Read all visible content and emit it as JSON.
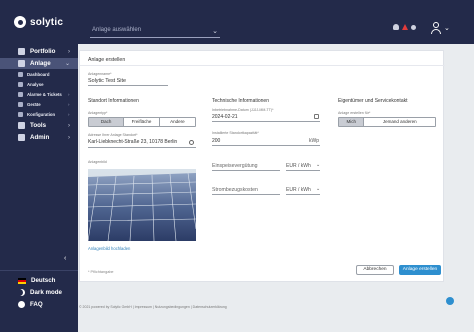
{
  "app": {
    "logo_text": "solytic"
  },
  "topbar": {
    "plant_select_placeholder": "Anlage auswählen",
    "icons": [
      "bell-icon",
      "alert-icon",
      "user-icon",
      "chevron-down-icon"
    ]
  },
  "sidebar": {
    "items": [
      {
        "label": "Portfolio",
        "icon": "portfolio-icon"
      },
      {
        "label": "Anlage",
        "icon": "plant-icon"
      }
    ],
    "sub_items": [
      {
        "label": "Dashboard",
        "icon": "dashboard-icon"
      },
      {
        "label": "Analyse",
        "icon": "analysis-icon"
      },
      {
        "label": "Alarme & Tickets",
        "icon": "alarm-icon"
      },
      {
        "label": "Geräte",
        "icon": "devices-icon"
      },
      {
        "label": "Konfiguration",
        "icon": "config-icon"
      }
    ],
    "lower_items": [
      {
        "label": "Tools",
        "icon": "tools-icon"
      },
      {
        "label": "Admin",
        "icon": "admin-icon"
      }
    ],
    "footer": [
      {
        "label": "Deutsch",
        "icon": "german-flag-icon"
      },
      {
        "label": "Dark mode",
        "icon": "moon-icon"
      },
      {
        "label": "FAQ",
        "icon": "help-icon"
      }
    ]
  },
  "form": {
    "title": "Anlage erstellen",
    "name_label": "Anlagenname*",
    "name_value": "Solytic Test Site",
    "section_location": "Standort Informationen",
    "section_technical": "Technische Informationen",
    "section_owner": "Eigentümer und Servicekontakt",
    "type_label": "Anlagentyp*",
    "type_options": [
      "Dach",
      "Freifläche",
      "Andere"
    ],
    "type_selected": "Dach",
    "address_label": "Adresse Ihrer Anlage Standort*",
    "address_value": "Karl-Liebknecht-Straße 23, 10178 Berlin",
    "photo_label": "Anlagenbild",
    "photo_link": "Anlagenbild hochladen",
    "commissioning_label": "Inbetriebnahme-Datum (JJJJ-MM-TT)*",
    "commissioning_value": "2024-02-21",
    "capacity_label": "Installierte Standortkapazität*",
    "capacity_value": "200",
    "capacity_unit": "kWp",
    "feed_in_placeholder": "Einspeisevergütung",
    "feed_in_unit": "EUR / kWh",
    "electricity_cost_placeholder": "Strombezugskosten",
    "electricity_cost_unit": "EUR / kWh",
    "owner_label": "Anlage erstellen für*",
    "owner_options": [
      "Mich",
      "Jemand anderen"
    ],
    "owner_selected": "Mich",
    "required_note": "* Pflichtangabe",
    "cancel_label": "Abbrechen",
    "submit_label": "Anlage erstellen"
  },
  "footer": {
    "text": "© 2021 powered by Solytic GmbH  |  Impressum  |  Nutzungsbedingungen  |  Datenschutzerklärung"
  },
  "colors": {
    "sidebar_bg": "#232a4a",
    "accent": "#2e8fcf",
    "alert": "#e23b3b"
  }
}
